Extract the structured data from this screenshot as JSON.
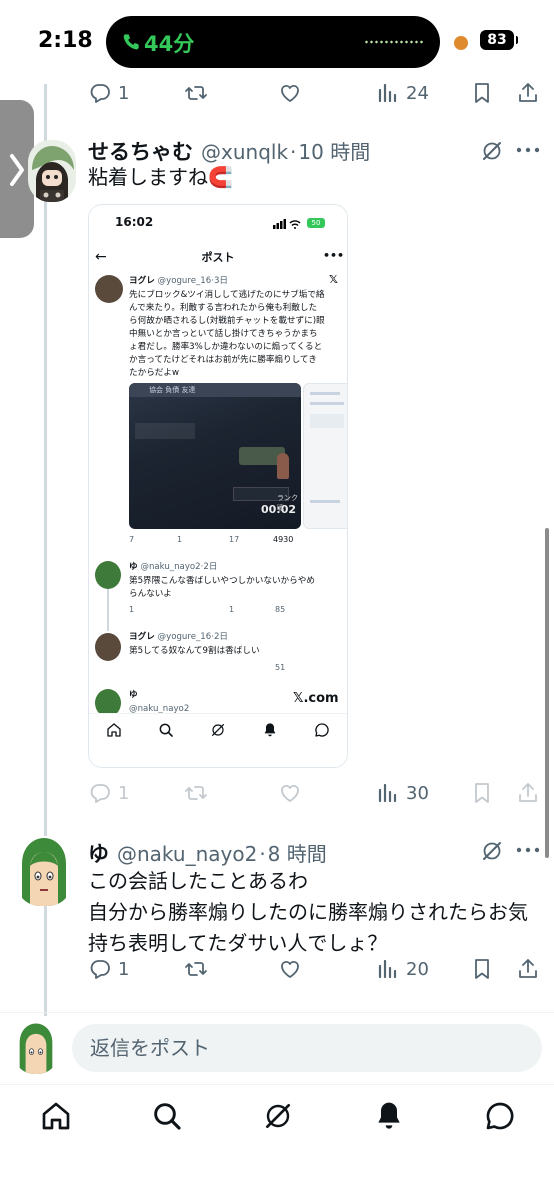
{
  "status_bar": {
    "time": "2:18",
    "call_duration": "44分",
    "battery": "83"
  },
  "tweet1_actions": {
    "replies": "1",
    "views": "24"
  },
  "tweet2": {
    "name": "せるちゃむ",
    "handle": "@xunqlk",
    "time": "10 時間",
    "text": "粘着しますね🧲",
    "actions": {
      "replies": "1",
      "views": "30"
    }
  },
  "embed": {
    "status_time": "16:02",
    "battery": "50",
    "title": "ポスト",
    "post1": {
      "name": "ヨグレ",
      "handle": "@yogure_16",
      "time": "3日",
      "lines": [
        "先にブロック&ツイ消しして逃げたのにサブ垢で絡",
        "んで来たり。利敵する言われたから俺も利敵した",
        "ら何故か晒されるし(対戦前チャットを載せずに)眼",
        "中無いとか言っといて話し掛けてきちゃうかまち",
        "ょ君だし。勝率3%しか違わないのに煽ってくると",
        "か言ってたけどそれはお前が先に勝率煽りしてき",
        "たからだよw"
      ],
      "reply_count": "7",
      "retweet_count": "1",
      "like_count": "17",
      "views": "4930"
    },
    "game_labels": {
      "hud_top": "協会  負債  友達",
      "bottom_time": "00:02",
      "rank": "ランク戦"
    },
    "reply1": {
      "name": "ゆ",
      "handle": "@naku_nayo2",
      "time": "2日",
      "lines": [
        "第5界隈こんな香ばしいやつしかいないからやめ",
        "らんないよ"
      ],
      "reply_count": "1",
      "like_count": "1",
      "views": "85"
    },
    "reply2": {
      "name": "ヨグレ",
      "handle": "@yogure_16",
      "time": "2日",
      "lines": [
        "第5してる奴なんて9割は香ばしい"
      ],
      "views": "51"
    },
    "reply3": {
      "name": "ゆ",
      "handle": "@naku_nayo2"
    },
    "watermark": "𝕏.com"
  },
  "tweet3": {
    "name": "ゆ",
    "handle": "@naku_nayo2",
    "time": "8 時間",
    "lines": [
      "この会話したことあるわ",
      "自分から勝率煽りしたのに勝率煽りされたらお気",
      "持ち表明してたダサい人でしょ？"
    ],
    "actions": {
      "replies": "1",
      "views": "20"
    }
  },
  "reply_box": {
    "placeholder": "返信をポスト"
  },
  "colors": {
    "text": "#0f1419",
    "muted": "#536471",
    "call_green": "#34c759",
    "border": "#eff3f4"
  },
  "icons": [
    "reply-icon",
    "retweet-icon",
    "like-icon",
    "views-icon",
    "bookmark-icon",
    "share-icon",
    "grok-icon",
    "more-icon",
    "home-icon",
    "search-icon",
    "bell-icon",
    "messages-icon"
  ]
}
